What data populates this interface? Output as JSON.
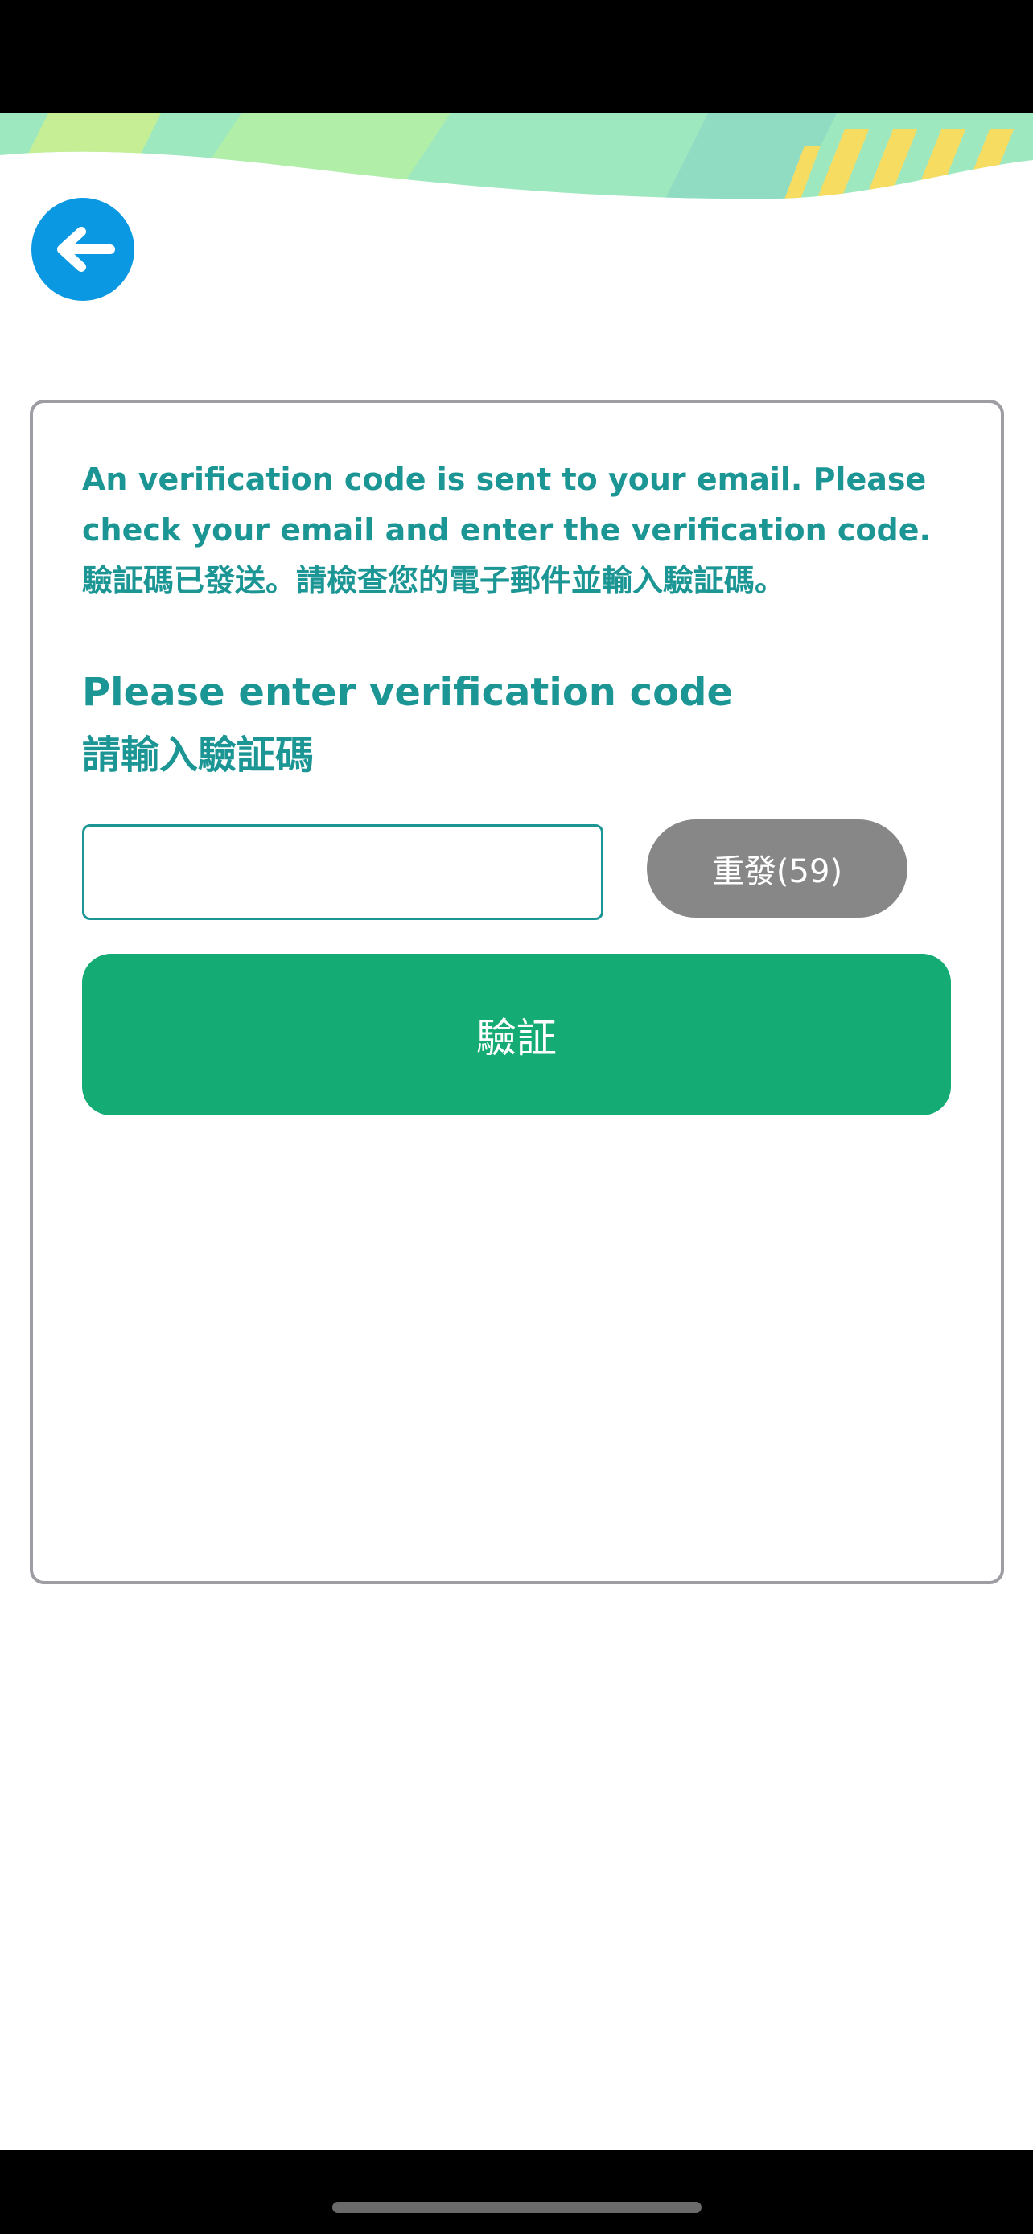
{
  "message": {
    "line1": "An verification code is sent to your email. Please",
    "line2": "check your email and enter the verification code.",
    "line3": "驗証碼已發送。請檢查您的電子郵件並輸入驗証碼。"
  },
  "prompt": {
    "english": "Please enter verification code",
    "chinese": "請輸入驗証碼"
  },
  "code_input": {
    "value": "",
    "placeholder": ""
  },
  "resend_button": {
    "label": "重發(59)"
  },
  "verify_button": {
    "label": "驗証"
  },
  "icons": {
    "back": "arrow-left-icon"
  },
  "colors": {
    "accent_teal": "#1c9694",
    "back_button_blue": "#0a98e2",
    "verify_green": "#14ab74",
    "resend_gray": "#878787",
    "card_border": "#9d9da3"
  }
}
